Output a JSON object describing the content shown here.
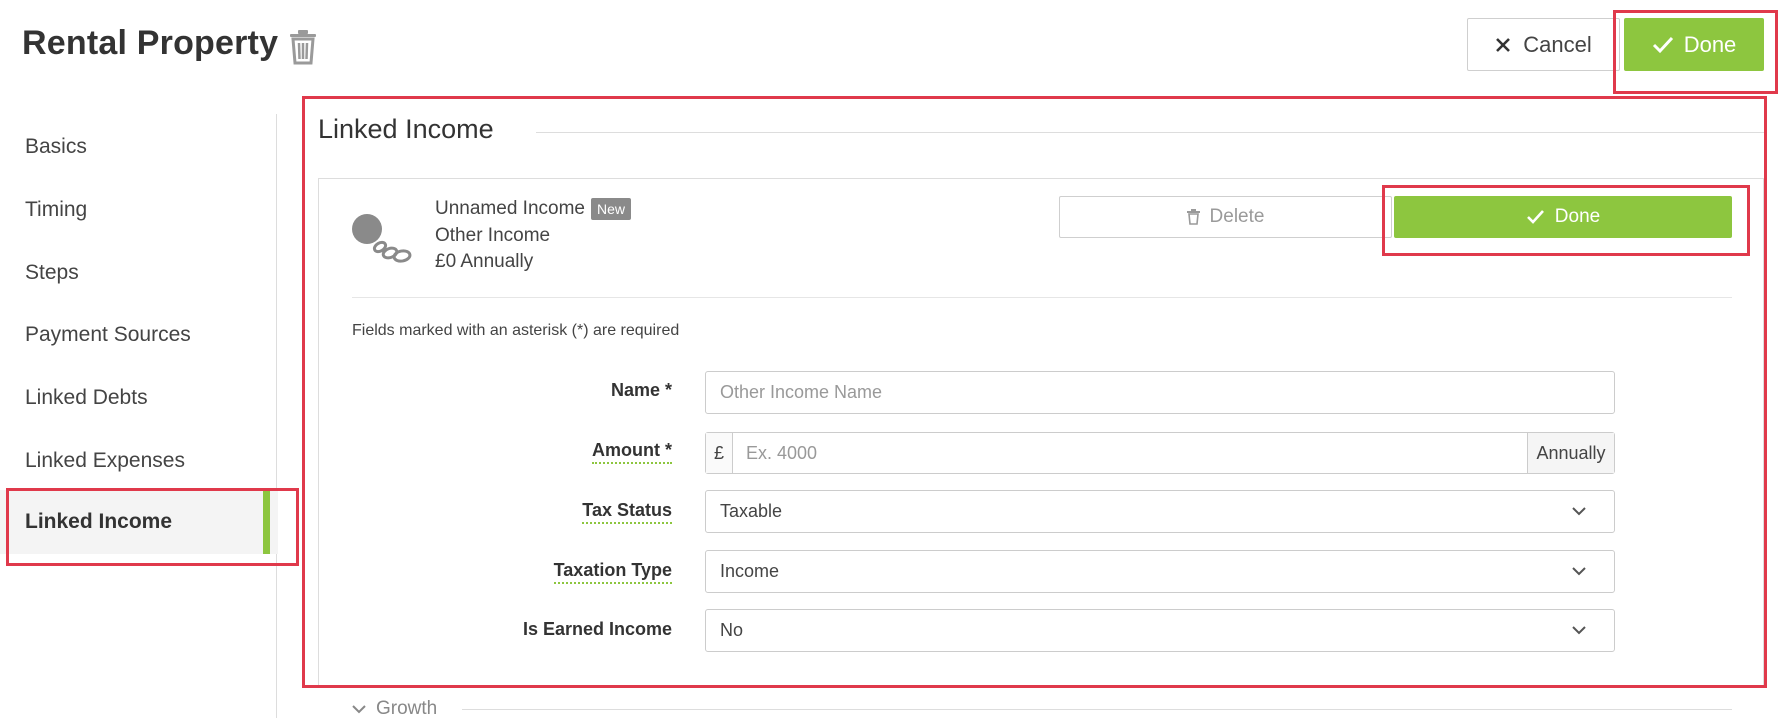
{
  "header": {
    "title": "Rental Property",
    "cancel_label": "Cancel",
    "done_label": "Done"
  },
  "sidebar": {
    "items": [
      {
        "label": "Basics"
      },
      {
        "label": "Timing"
      },
      {
        "label": "Steps"
      },
      {
        "label": "Payment Sources"
      },
      {
        "label": "Linked Debts"
      },
      {
        "label": "Linked Expenses"
      },
      {
        "label": "Linked Income"
      }
    ],
    "active": "Linked Income"
  },
  "section": {
    "title": "Linked Income"
  },
  "income": {
    "name": "Unnamed Income",
    "badge": "New",
    "type": "Other Income",
    "amount": "£0 Annually",
    "delete_label": "Delete",
    "done_label": "Done"
  },
  "form": {
    "required_note": "Fields marked with an asterisk (*) are required",
    "name": {
      "label": "Name *",
      "placeholder": "Other Income Name",
      "value": ""
    },
    "amount": {
      "label": "Amount *",
      "prefix": "£",
      "placeholder": "Ex. 4000",
      "suffix": "Annually",
      "value": ""
    },
    "tax_status": {
      "label": "Tax Status",
      "value": "Taxable"
    },
    "taxation_type": {
      "label": "Taxation Type",
      "value": "Income"
    },
    "is_earned_income": {
      "label": "Is Earned Income",
      "value": "No"
    }
  },
  "growth": {
    "label": "Growth"
  },
  "colors": {
    "accent": "#8dc63f",
    "highlight": "#e0394b"
  },
  "icons": {
    "title_action": "trash-icon",
    "cancel": "close-icon",
    "done": "checkmark-icon",
    "income": "coins-icon",
    "dropdown": "chevron-down-icon"
  }
}
